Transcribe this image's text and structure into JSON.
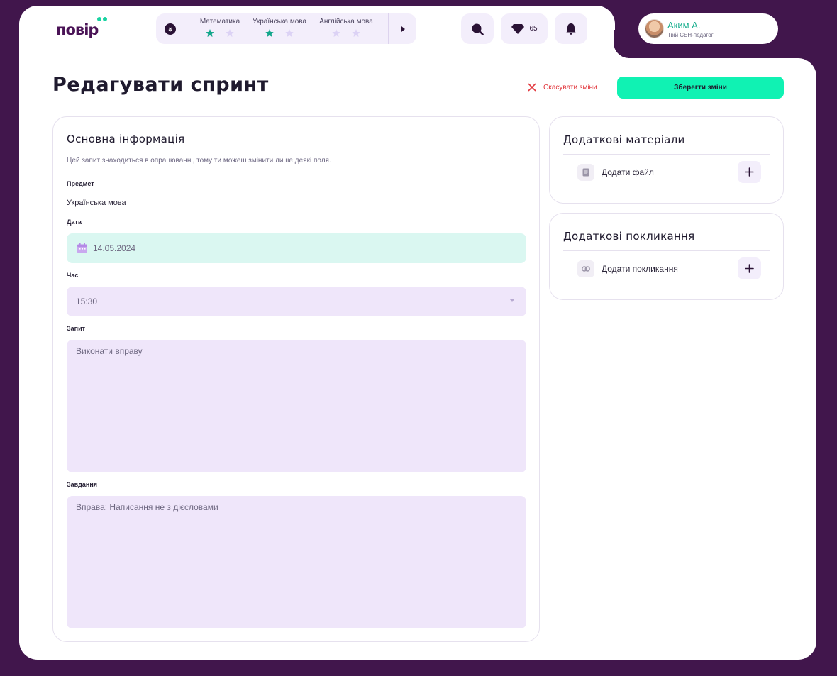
{
  "app": {
    "logo_text": "повір"
  },
  "subjects": [
    {
      "name": "Математика",
      "stars_filled": 1,
      "stars_total": 2
    },
    {
      "name": "Українська мова",
      "stars_filled": 1,
      "stars_total": 2
    },
    {
      "name": "Англійська мова",
      "stars_filled": 0,
      "stars_total": 2
    }
  ],
  "header": {
    "gems_count": "65"
  },
  "user": {
    "name": "Аким А.",
    "role": "Твій СЕН-педагог"
  },
  "page": {
    "title": "Редагувати спринт",
    "cancel_label": "Скасувати зміни",
    "save_label": "Зберегти зміни"
  },
  "main_card": {
    "title": "Основна інформація",
    "note": "Цей запит знаходиться в опрацюванні, тому ти можеш змінити лише деякі поля.",
    "subject_label": "Предмет",
    "subject_value": "Українська мова",
    "date_label": "Дата",
    "date_value": "14.05.2024",
    "time_label": "Час",
    "time_value": "15:30",
    "request_label": "Запит",
    "request_value": "Виконати вправу",
    "task_label": "Завдання",
    "task_value": "Вправа; Написання не з дієсловами"
  },
  "materials": {
    "title": "Додаткові матеріали",
    "add_label": "Додати файл"
  },
  "links": {
    "title": "Додаткові покликання",
    "add_label": "Додати покликання"
  },
  "colors": {
    "background": "#41164c",
    "accent": "#10f2b3",
    "star_filled": "#12a68b",
    "star_empty": "#dcd2f5",
    "danger": "#e2373d"
  }
}
